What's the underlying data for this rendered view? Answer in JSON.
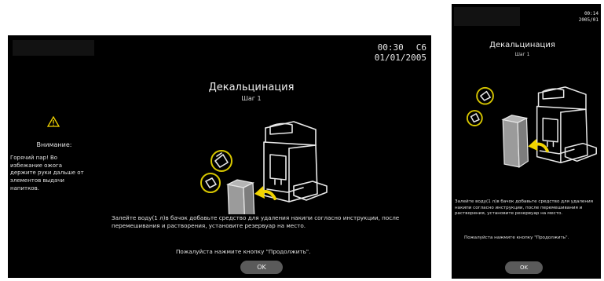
{
  "main": {
    "time": "00:30",
    "code": "C6",
    "date": "01/01/2005",
    "title": "Декальцинация",
    "step": "Шаг 1",
    "warning_title": "Внимание:",
    "warning_text": "Горячий пар! Во избежание ожога держите руки дальше от элементов выдачи напитков.",
    "instruction": "Залейте воду(1 л)в бачок добавьте средство для удаления накипи согласно инструкции, после перемешивания и растворения, установите резервуар на место.",
    "prompt": "Пожалуйста нажмите кнопку \"Продолжить\".",
    "ok_label": "OK"
  },
  "side": {
    "time": "00:14",
    "date": "2005/01",
    "title": "Декальцинация",
    "step": "Шаг 1",
    "instruction": "Залейте воду(1 л)в бачок добавьте средство для удаления накипи согласно инструкции, после перемешивания и растворения, установите резервуар на место.",
    "prompt": "Пожалуйста нажмите кнопку \"Продолжить\".",
    "ok_label": "OK"
  },
  "colors": {
    "screen_bg": "#000000",
    "accent": "#f2d400",
    "button": "#5a5a5a"
  },
  "icons": [
    "warning-icon",
    "coffee-machine-illustration",
    "water-tank-illustration",
    "powder-icon",
    "decalcifier-icon",
    "insert-arrow-icon"
  ]
}
